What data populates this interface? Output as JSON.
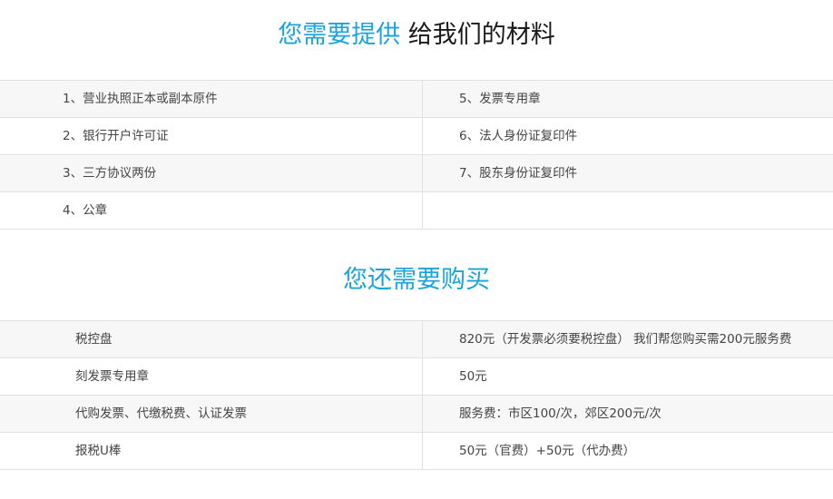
{
  "materials": {
    "title_highlight": "您需要提供",
    "title_rest": "给我们的材料",
    "rows": [
      {
        "left": "1、营业执照正本或副本原件",
        "right": "5、发票专用章"
      },
      {
        "left": "2、银行开户许可证",
        "right": "6、法人身份证复印件"
      },
      {
        "left": "3、三方协议两份",
        "right": "7、股东身份证复印件"
      },
      {
        "left": "4、公章",
        "right": ""
      }
    ]
  },
  "purchase": {
    "title": "您还需要购买",
    "rows": [
      {
        "item": "税控盘",
        "price": "820元（开发票必须要税控盘） 我们帮您购买需200元服务费"
      },
      {
        "item": "刻发票专用章",
        "price": "50元"
      },
      {
        "item": "代购发票、代缴税费、认证发票",
        "price": "服务费：市区100/次，郊区200元/次"
      },
      {
        "item": "报税U棒",
        "price": "50元（官费）+50元（代办费）"
      }
    ]
  },
  "colors": {
    "accent": "#1aa3de",
    "title_dark": "#1a1a1a",
    "text": "#444444",
    "row_shade": "#f7f7f7",
    "border": "#e1e1e1"
  }
}
